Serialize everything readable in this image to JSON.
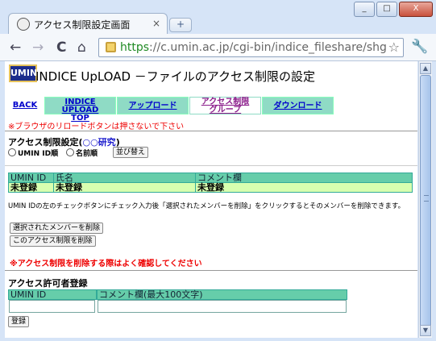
{
  "browser": {
    "tab_title": "アクセス制限設定画面",
    "tab_close": "×",
    "new_tab": "+",
    "url_scheme": "https",
    "url_rest": "://c.umin.ac.jp/cgi-bin/indice_fileshare/shgr",
    "win_min": "_",
    "win_max": "□",
    "win_close": "X",
    "nav_back": "←",
    "nav_forward": "→",
    "nav_reload": "C",
    "nav_home": "⌂",
    "bookmark_star": "☆",
    "menu_wrench": "🔧"
  },
  "page": {
    "logo_text": "UMIN",
    "heading": "INDICE UpLOAD －ファイルのアクセス制限の設定",
    "nav": {
      "back": "BACK",
      "top_line1": "INDICE UPLOAD",
      "top_line2": "TOP",
      "upload": "アップロード",
      "access_line1": "アクセス制限",
      "access_line2": "グループ",
      "download": "ダウンロード"
    },
    "reload_warning": "※ブラウザのリロードボタンは押さないで下さい",
    "access_title_prefix": "アクセス制限設定(",
    "access_title_group": "○○研究",
    "access_title_suffix": ")",
    "sort_umin": "UMIN ID順",
    "sort_name": "名前順",
    "sort_button": "並び替え",
    "table": {
      "headers": [
        "UMIN ID",
        "氏名",
        "コメント欄"
      ],
      "row": [
        "未登録",
        "未登録",
        "未登録"
      ]
    },
    "instructions": "UMIN IDの左のチェックボタンにチェック入力後「選択されたメンバーを削除」をクリックするとそのメンバーを削除できます。",
    "delete_selected": "選択されたメンバーを削除",
    "delete_restriction": "このアクセス制限を削除",
    "delete_warning": "※アクセス制限を削除する際はよく確認してください",
    "register_title": "アクセス許可者登録",
    "register_headers": [
      "UMIN ID",
      "コメント欄(最大100文字)"
    ],
    "register_button": "登録"
  }
}
